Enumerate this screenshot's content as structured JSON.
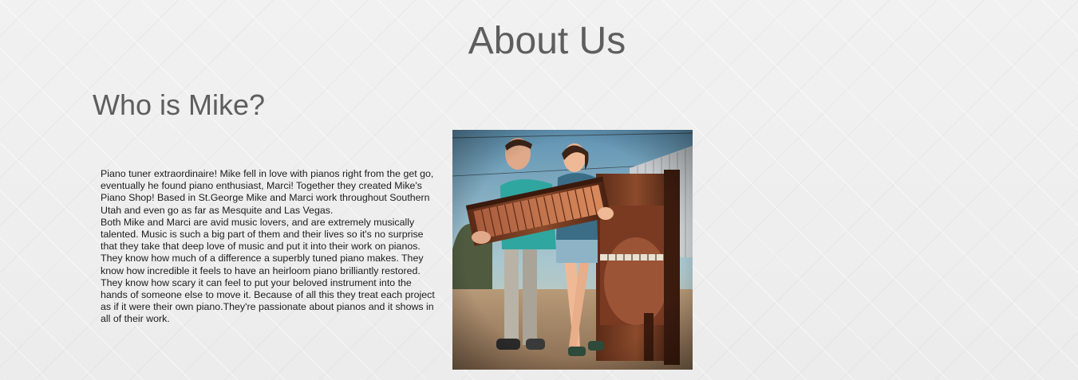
{
  "page": {
    "title": "About Us"
  },
  "section": {
    "heading": "Who is Mike?",
    "paragraphs": [
      "Piano tuner extraordinaire! Mike fell in love with pianos right from the get go, eventually he found piano enthusiast, Marci! Together they created Mike's Piano Shop! Based in St.George Mike and Marci work throughout Southern Utah and even go as far as Mesquite and Las Vegas.",
      "Both Mike and Marci are avid music lovers, and are extremely musically talented. Music is such a big part of them and their lives so it's no surprise that they take that deep love of music and put it into their work on pianos. They know how much of a difference a superbly tuned piano makes. They know how incredible it feels to have an heirloom piano brilliantly restored. They know how scary it can feel to put your beloved instrument into the hands of someone else to move it. Because of all this they treat each project as if it were their own piano.They're passionate about pianos and it shows in all of their work."
    ],
    "photo_icon": "photo-mike-and-marci-with-piano"
  },
  "colors": {
    "heading": "#5e5e5e",
    "body_text": "#1c1c1c",
    "background": "#efefef"
  }
}
